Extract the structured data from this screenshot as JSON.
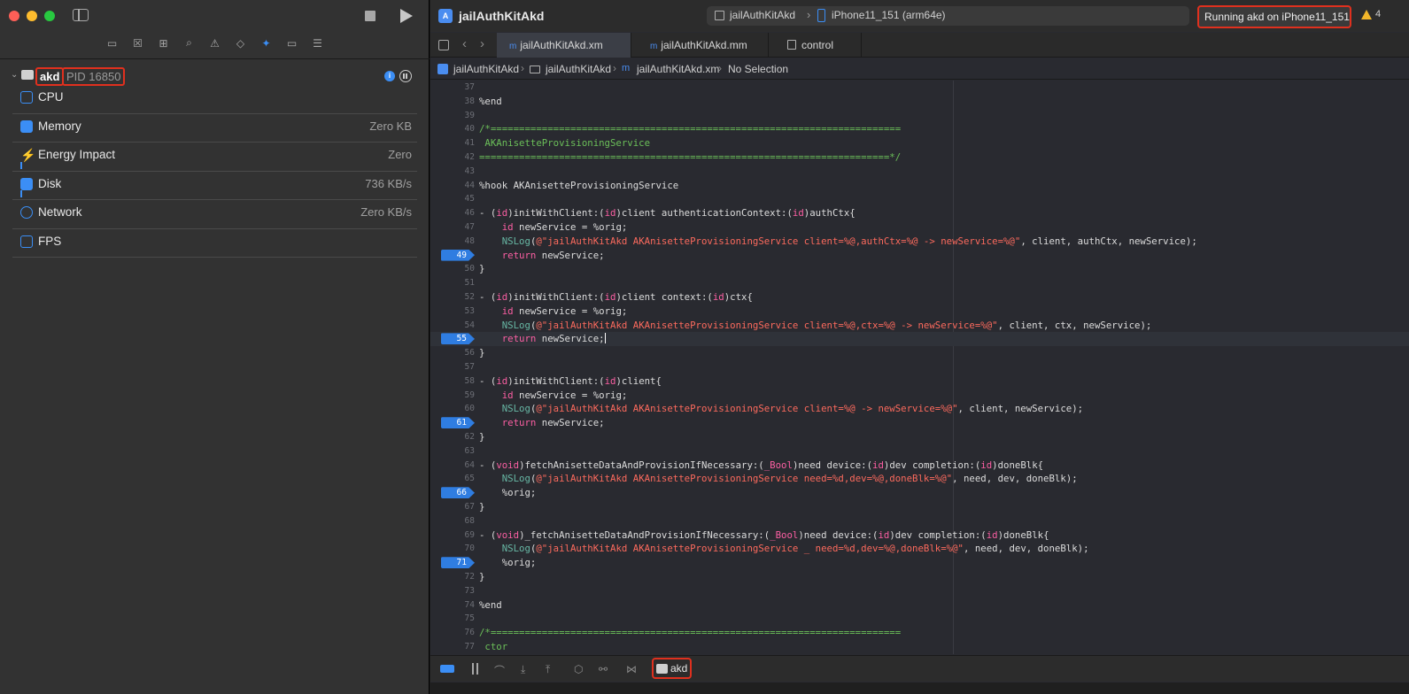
{
  "window": {
    "title": "jailAuthKitAkd"
  },
  "scheme": {
    "target": "jailAuthKitAkd",
    "device": "iPhone11_151 (arm64e)"
  },
  "status": {
    "text": "Running akd on iPhone11_151",
    "warnings": "4"
  },
  "navigator": {
    "process": {
      "name": "akd",
      "pid": "PID 16850"
    },
    "gauges": [
      {
        "label": "CPU",
        "value": ""
      },
      {
        "label": "Memory",
        "value": "Zero KB"
      },
      {
        "label": "Energy Impact",
        "value": "Zero"
      },
      {
        "label": "Disk",
        "value": "736 KB/s"
      },
      {
        "label": "Network",
        "value": "Zero KB/s"
      },
      {
        "label": "FPS",
        "value": ""
      }
    ]
  },
  "tabs": [
    {
      "label": "jailAuthKitAkd.xm",
      "active": true
    },
    {
      "label": "jailAuthKitAkd.mm",
      "active": false
    },
    {
      "label": "control",
      "active": false
    }
  ],
  "jumpbar": {
    "project": "jailAuthKitAkd",
    "folder": "jailAuthKitAkd",
    "file": "jailAuthKitAkd.xm",
    "selection": "No Selection"
  },
  "code": {
    "lines": [
      {
        "n": "37",
        "html": ""
      },
      {
        "n": "38",
        "html": "%end"
      },
      {
        "n": "39",
        "html": ""
      },
      {
        "n": "40",
        "html": "<span class=\"cm\">/*========================================================================</span>"
      },
      {
        "n": "41",
        "html": "<span class=\"cm\"> AKAnisetteProvisioningService</span>"
      },
      {
        "n": "42",
        "html": "<span class=\"cm\">========================================================================*/</span>"
      },
      {
        "n": "43",
        "html": ""
      },
      {
        "n": "44",
        "html": "%hook AKAnisetteProvisioningService"
      },
      {
        "n": "45",
        "html": ""
      },
      {
        "n": "46",
        "html": "- (<span class=\"kw\">id</span>)initWithClient:(<span class=\"kw\">id</span>)client authenticationContext:(<span class=\"kw\">id</span>)authCtx{"
      },
      {
        "n": "47",
        "html": "    <span class=\"kw\">id</span> newService = %orig;"
      },
      {
        "n": "48",
        "html": "    <span class=\"fn\">NSLog</span>(<span class=\"str\">@\"jailAuthKitAkd AKAnisetteProvisioningService client=%@,authCtx=%@ -> newService=%@\"</span>, client, authCtx, newService);"
      },
      {
        "n": "49",
        "html": "    <span class=\"kw\">return</span> newService;",
        "bp": true
      },
      {
        "n": "50",
        "html": "}"
      },
      {
        "n": "51",
        "html": ""
      },
      {
        "n": "52",
        "html": "- (<span class=\"kw\">id</span>)initWithClient:(<span class=\"kw\">id</span>)client context:(<span class=\"kw\">id</span>)ctx{"
      },
      {
        "n": "53",
        "html": "    <span class=\"kw\">id</span> newService = %orig;"
      },
      {
        "n": "54",
        "html": "    <span class=\"fn\">NSLog</span>(<span class=\"str\">@\"jailAuthKitAkd AKAnisetteProvisioningService client=%@,ctx=%@ -> newService=%@\"</span>, client, ctx, newService);"
      },
      {
        "n": "55",
        "html": "    <span class=\"kw\">return</span> newService;<span class=\"cursor\"></span>",
        "bp": true,
        "current": true
      },
      {
        "n": "56",
        "html": "}"
      },
      {
        "n": "57",
        "html": ""
      },
      {
        "n": "58",
        "html": "- (<span class=\"kw\">id</span>)initWithClient:(<span class=\"kw\">id</span>)client{"
      },
      {
        "n": "59",
        "html": "    <span class=\"kw\">id</span> newService = %orig;"
      },
      {
        "n": "60",
        "html": "    <span class=\"fn\">NSLog</span>(<span class=\"str\">@\"jailAuthKitAkd AKAnisetteProvisioningService client=%@ -> newService=%@\"</span>, client, newService);"
      },
      {
        "n": "61",
        "html": "    <span class=\"kw\">return</span> newService;",
        "bp": true
      },
      {
        "n": "62",
        "html": "}"
      },
      {
        "n": "63",
        "html": ""
      },
      {
        "n": "64",
        "html": "- (<span class=\"kw\">void</span>)fetchAnisetteDataAndProvisionIfNecessary:(<span class=\"kw\">_Bool</span>)need device:(<span class=\"kw\">id</span>)dev completion:(<span class=\"kw\">id</span>)doneBlk{"
      },
      {
        "n": "65",
        "html": "    <span class=\"fn\">NSLog</span>(<span class=\"str\">@\"jailAuthKitAkd AKAnisetteProvisioningService need=%d,dev=%@,doneBlk=%@\"</span>, need, dev, doneBlk);"
      },
      {
        "n": "66",
        "html": "    %orig;",
        "bp": true
      },
      {
        "n": "67",
        "html": "}"
      },
      {
        "n": "68",
        "html": ""
      },
      {
        "n": "69",
        "html": "- (<span class=\"kw\">void</span>)_fetchAnisetteDataAndProvisionIfNecessary:(<span class=\"kw\">_Bool</span>)need device:(<span class=\"kw\">id</span>)dev completion:(<span class=\"kw\">id</span>)doneBlk{"
      },
      {
        "n": "70",
        "html": "    <span class=\"fn\">NSLog</span>(<span class=\"str\">@\"jailAuthKitAkd AKAnisetteProvisioningService _ need=%d,dev=%@,doneBlk=%@\"</span>, need, dev, doneBlk);"
      },
      {
        "n": "71",
        "html": "    %orig;",
        "bp": true
      },
      {
        "n": "72",
        "html": "}"
      },
      {
        "n": "73",
        "html": ""
      },
      {
        "n": "74",
        "html": "%end"
      },
      {
        "n": "75",
        "html": ""
      },
      {
        "n": "76",
        "html": "<span class=\"cm\">/*========================================================================</span>"
      },
      {
        "n": "77",
        "html": "<span class=\"cm\"> ctor</span>"
      }
    ]
  },
  "debug": {
    "process": "akd"
  },
  "icons": {
    "navigator": [
      "folder-icon",
      "source-control-icon",
      "hierarchy-icon",
      "search-icon",
      "warning-icon",
      "test-icon",
      "debug-navigator-icon",
      "breakpoint-icon",
      "report-icon"
    ]
  }
}
